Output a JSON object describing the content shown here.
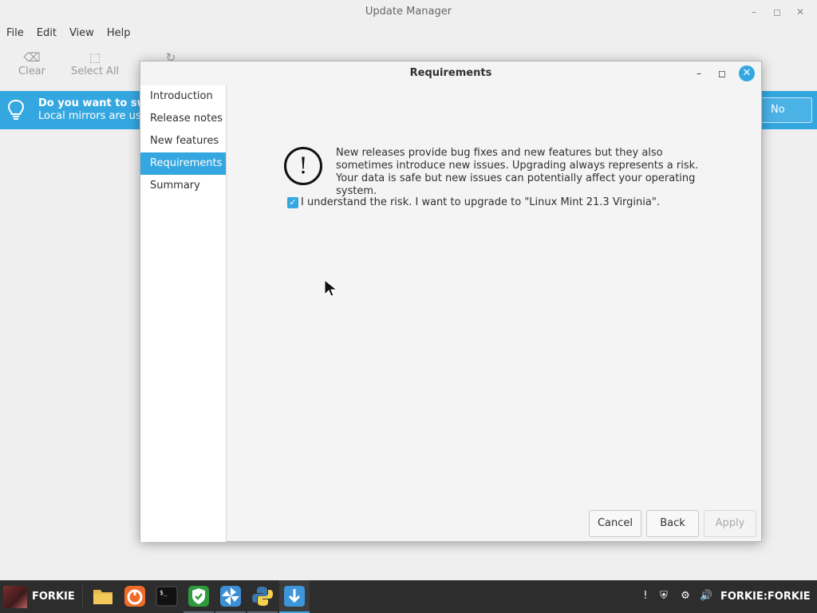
{
  "background_window": {
    "title": "Update Manager",
    "menu": [
      "File",
      "Edit",
      "View",
      "Help"
    ],
    "toolbar": {
      "clear_label": "Clear",
      "select_all_label": "Select All"
    },
    "infobar": {
      "title": "Do you want to swit",
      "subtitle": "Local mirrors are usu",
      "no_label": "No"
    }
  },
  "dialog": {
    "title": "Requirements",
    "sidebar": {
      "items": [
        {
          "label": "Introduction",
          "active": false
        },
        {
          "label": "Release notes",
          "active": false
        },
        {
          "label": "New features",
          "active": false
        },
        {
          "label": "Requirements",
          "active": true
        },
        {
          "label": "Summary",
          "active": false
        }
      ]
    },
    "warning_text": "New releases provide bug fixes and new features but they also sometimes introduce new issues. Upgrading always represents a risk. Your data is safe but new issues can potentially affect your operating system.",
    "risk_checkbox": {
      "label": "I understand the risk. I want to upgrade to \"Linux Mint 21.3 Virginia\".",
      "checked": true
    },
    "buttons": {
      "cancel": "Cancel",
      "back": "Back",
      "apply": "Apply"
    }
  },
  "taskbar": {
    "menu_label": "FORKIE",
    "apps": [
      {
        "icon": "folder-icon",
        "state": "normal"
      },
      {
        "icon": "firefox-icon",
        "state": "normal"
      },
      {
        "icon": "terminal-icon",
        "state": "normal"
      },
      {
        "icon": "shield-app-icon",
        "state": "running"
      },
      {
        "icon": "pinwheel-app-icon",
        "state": "running"
      },
      {
        "icon": "python-icon",
        "state": "running"
      },
      {
        "icon": "update-manager-icon",
        "state": "active"
      }
    ],
    "tray_user": "FORKIE:FORKIE"
  },
  "colors": {
    "accent": "#35a7e0",
    "taskbar": "#2d2d2d"
  }
}
